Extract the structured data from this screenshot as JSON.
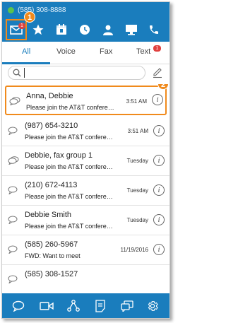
{
  "status": {
    "phone": "(585) 308-8888",
    "presence_color": "#5ac34e"
  },
  "colors": {
    "brand": "#1a7dbd",
    "highlight": "#f08a1c",
    "badge": "#e0413f"
  },
  "navbar": {
    "icons": [
      "envelope-icon",
      "star-icon",
      "calendar-icon",
      "clock-icon",
      "person-icon",
      "monitor-icon",
      "phone-icon"
    ],
    "messages_badge": "1"
  },
  "callouts": {
    "first": "1",
    "second": "2"
  },
  "tabs": [
    {
      "label": "All"
    },
    {
      "label": "Voice"
    },
    {
      "label": "Fax"
    },
    {
      "label": "Text",
      "badge": "1"
    }
  ],
  "search": {
    "placeholder": ""
  },
  "messages": [
    {
      "name": "Anna, Debbie",
      "preview": "Please join the AT&T conference...",
      "time": "3:51 AM",
      "icon": "group-chat-icon"
    },
    {
      "name": "(987) 654-3210",
      "preview": "Please join the AT&T conference...",
      "time": "3:51 AM",
      "icon": "chat-icon"
    },
    {
      "name": "Debbie, fax group 1",
      "preview": "Please join the AT&T conference...",
      "time": "Tuesday",
      "icon": "group-chat-icon"
    },
    {
      "name": "(210) 672-4113",
      "preview": "Please join the AT&T conference...",
      "time": "Tuesday",
      "icon": "chat-icon"
    },
    {
      "name": "Debbie Smith",
      "preview": "Please join the AT&T conference...",
      "time": "Tuesday",
      "icon": "chat-icon"
    },
    {
      "name": "(585) 260-5967",
      "preview": "FWD: Want to meet",
      "time": "11/19/2016",
      "icon": "chat-icon"
    },
    {
      "name": "(585) 308-1527",
      "preview": "",
      "time": "",
      "icon": "chat-icon"
    }
  ],
  "bottombar": {
    "icons": [
      "chat-bubble-icon",
      "video-icon",
      "network-icon",
      "notes-icon",
      "conversations-icon",
      "settings-icon"
    ]
  }
}
